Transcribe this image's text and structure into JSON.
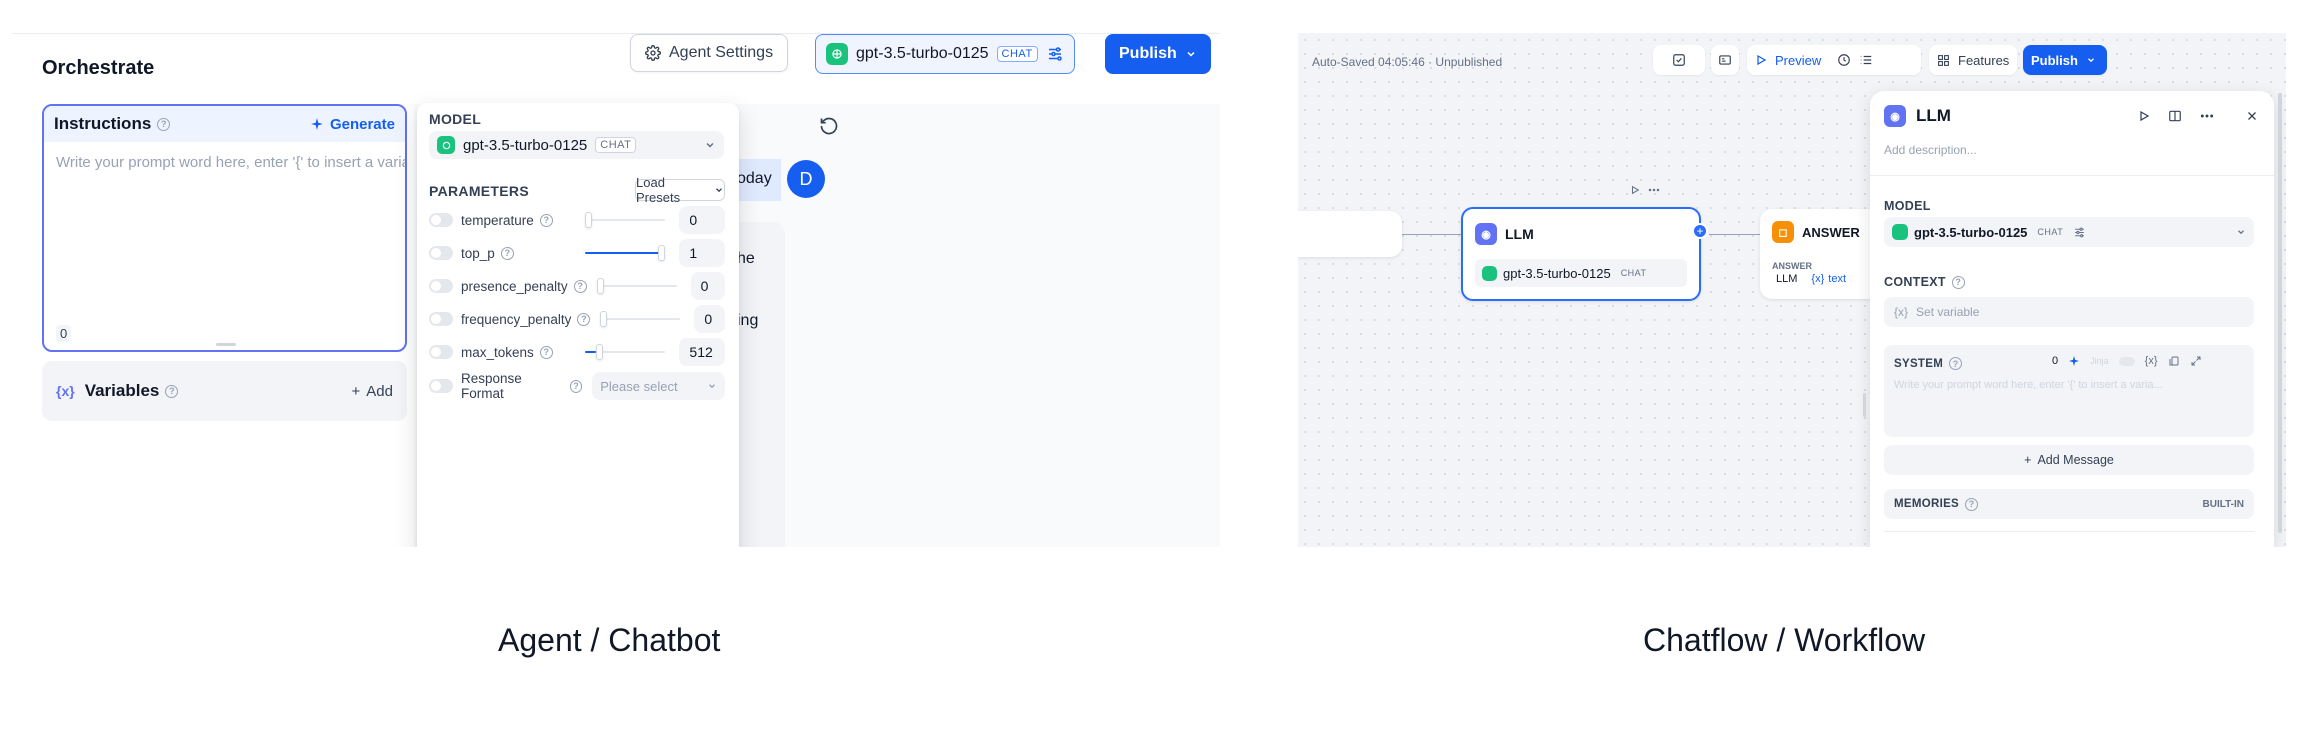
{
  "agent": {
    "title": "Orchestrate",
    "agent_settings_label": "Agent Settings",
    "model_name": "gpt-3.5-turbo-0125",
    "model_mode": "CHAT",
    "publish_label": "Publish",
    "instructions": {
      "title": "Instructions",
      "generate_label": "Generate",
      "placeholder": "Write your prompt word here, enter '{' to insert a variable, enter '...",
      "char_count": "0"
    },
    "variables": {
      "title": "Variables",
      "add_label": "Add"
    },
    "chat_fragments": {
      "today": "oday",
      "the": "he",
      "ing": "ing",
      "avatar_initial": "D"
    },
    "popover": {
      "model_label": "MODEL",
      "model_name": "gpt-3.5-turbo-0125",
      "model_mode": "CHAT",
      "parameters_label": "PARAMETERS",
      "load_presets_label": "Load Presets",
      "params": [
        {
          "name": "temperature",
          "value": "0",
          "fill": 0.0
        },
        {
          "name": "top_p",
          "value": "1",
          "fill": 1.0
        },
        {
          "name": "presence_penalty",
          "value": "0",
          "fill": 0.0
        },
        {
          "name": "frequency_penalty",
          "value": "0",
          "fill": 0.0
        },
        {
          "name": "max_tokens",
          "value": "512",
          "fill": 0.14
        }
      ],
      "response_format": {
        "name": "Response Format",
        "placeholder": "Please select"
      }
    }
  },
  "workflow": {
    "autosave": "Auto-Saved 04:05:46 · Unpublished",
    "preview_label": "Preview",
    "features_label": "Features",
    "publish_label": "Publish",
    "llm_node": {
      "title": "LLM",
      "model": "gpt-3.5-turbo-0125",
      "mode": "CHAT"
    },
    "answer_node": {
      "title": "ANSWER",
      "sub_label": "ANSWER",
      "ref_node": "LLM",
      "ref_var": "text"
    },
    "inspector": {
      "title": "LLM",
      "description_placeholder": "Add description...",
      "model_label": "MODEL",
      "model_name": "gpt-3.5-turbo-0125",
      "model_mode": "CHAT",
      "context_label": "CONTEXT",
      "context_placeholder": "Set variable",
      "system_label": "SYSTEM",
      "system_count": "0",
      "jinja_label": "Jinja",
      "system_placeholder": "Write your prompt word here, enter '{' to insert a varia...",
      "add_message_label": "Add Message",
      "memories_label": "MEMORIES",
      "memories_badge": "BUILT-IN"
    }
  },
  "captions": {
    "left": "Agent / Chatbot",
    "right": "Chatflow / Workflow"
  },
  "colors": {
    "primary": "#155eef",
    "accent_indigo": "#6172f3",
    "openai_green": "#19c37d",
    "answer_orange": "#f79009"
  }
}
